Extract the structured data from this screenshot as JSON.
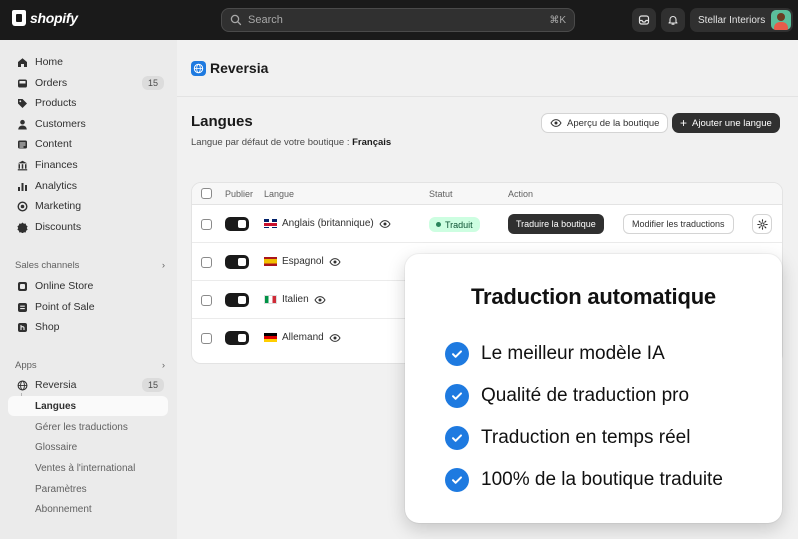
{
  "topbar": {
    "logo_text": "shopify",
    "search_placeholder": "Search",
    "search_shortcut": "⌘K",
    "store_name": "Stellar Interiors"
  },
  "sidebar": {
    "main_items": [
      {
        "label": "Home",
        "icon": "home-icon"
      },
      {
        "label": "Orders",
        "icon": "inbox-icon",
        "badge": "15"
      },
      {
        "label": "Products",
        "icon": "tag-icon"
      },
      {
        "label": "Customers",
        "icon": "person-icon"
      },
      {
        "label": "Content",
        "icon": "content-icon"
      },
      {
        "label": "Finances",
        "icon": "bank-icon"
      },
      {
        "label": "Analytics",
        "icon": "bar-chart-icon"
      },
      {
        "label": "Marketing",
        "icon": "target-icon"
      },
      {
        "label": "Discounts",
        "icon": "discount-icon"
      }
    ],
    "sales_channels_title": "Sales channels",
    "sales_channels": [
      {
        "label": "Online Store",
        "icon": "store-icon"
      },
      {
        "label": "Point of Sale",
        "icon": "pos-icon"
      },
      {
        "label": "Shop",
        "icon": "shop-icon"
      }
    ],
    "apps_title": "Apps",
    "app": {
      "label": "Reversia",
      "badge": "15",
      "icon": "globe-icon"
    },
    "app_sub_items": [
      {
        "label": "Langues",
        "active": true
      },
      {
        "label": "Gérer les traductions"
      },
      {
        "label": "Glossaire"
      },
      {
        "label": "Ventes à l'international"
      },
      {
        "label": "Paramètres"
      },
      {
        "label": "Abonnement"
      }
    ]
  },
  "main": {
    "app_name": "Reversia",
    "page_title": "Langues",
    "default_lang_prefix": "Langue par défaut de votre boutique : ",
    "default_lang": "Français",
    "btn_preview": "Aperçu de la boutique",
    "btn_add": "Ajouter une langue",
    "table": {
      "headers": {
        "publish": "Publier",
        "language": "Langue",
        "status": "Statut",
        "action": "Action"
      },
      "rows": [
        {
          "name": "Anglais (britannique)",
          "flag": "uk",
          "published": true,
          "status": "Traduit",
          "translate_label": "Traduire la boutique",
          "modify_label": "Modifier les traductions"
        },
        {
          "name": "Espagnol",
          "flag": "es",
          "published": true
        },
        {
          "name": "Italien",
          "flag": "it",
          "published": true
        },
        {
          "name": "Allemand",
          "flag": "de",
          "published": true
        }
      ]
    }
  },
  "promo": {
    "title": "Traduction automatique",
    "items": [
      "Le meilleur modèle IA",
      "Qualité de traduction pro",
      "Traduction en temps réel",
      "100% de la boutique traduite"
    ],
    "accent_color": "#1e7ae0"
  }
}
